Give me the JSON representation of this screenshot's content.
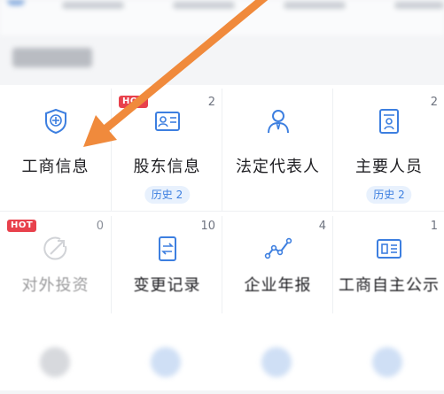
{
  "grid": {
    "row1": [
      {
        "label": "工商信息",
        "icon": "shield-badge-icon"
      },
      {
        "label": "股东信息",
        "icon": "id-card-icon",
        "count": "2",
        "history": "历史 2",
        "hot": "HOT"
      },
      {
        "label": "法定代表人",
        "icon": "person-tie-icon"
      },
      {
        "label": "主要人员",
        "icon": "person-document-icon",
        "count": "2",
        "history": "历史 2"
      }
    ],
    "row2": [
      {
        "label": "对外投资",
        "icon": "investment-arrow-icon",
        "count": "0",
        "hot": "HOT"
      },
      {
        "label": "变更记录",
        "icon": "change-record-icon",
        "count": "10"
      },
      {
        "label": "企业年报",
        "icon": "trend-line-icon",
        "count": "4"
      },
      {
        "label": "工商自主公示",
        "icon": "public-notice-icon",
        "count": "1"
      }
    ]
  },
  "colors": {
    "accent": "#3d7fe0",
    "hot": "#e8414c",
    "arrow": "#f08a3c"
  }
}
